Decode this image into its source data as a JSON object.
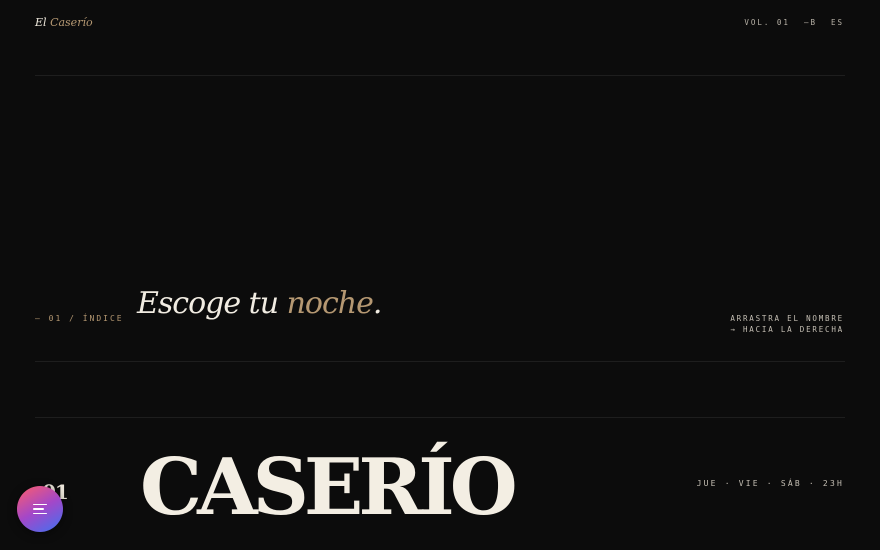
{
  "brand": {
    "prefix": "El",
    "name": "Caserío"
  },
  "nav": {
    "volume": "VOL. 01",
    "theme_toggle": "—B",
    "language": "ES"
  },
  "section": {
    "index_label": "— 01 / ÍNDICE",
    "headline_start": "Escoge tu ",
    "headline_accent": "noche",
    "headline_end": ".",
    "hint_line1": "ARRASTRA EL NOMBRE",
    "hint_line2": "→ HACIA LA DERECHA"
  },
  "item": {
    "number": "01",
    "name": "CASERÍO",
    "schedule": "JUE · VIE · SÁB · 23H"
  },
  "menu_button": {
    "icon": "menu-icon"
  },
  "colors": {
    "background": "#0c0c0c",
    "accent": "#b59872",
    "text": "#ece6da"
  }
}
